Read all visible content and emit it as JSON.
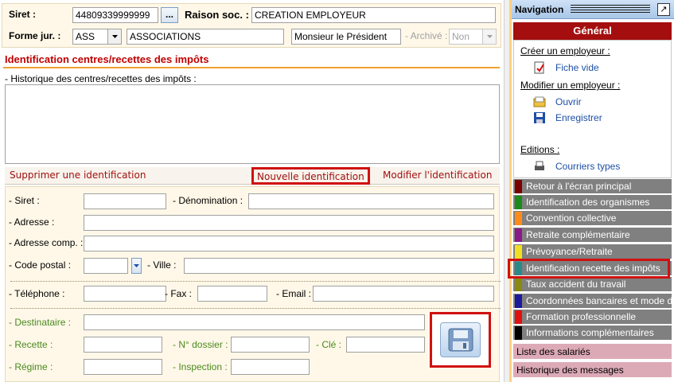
{
  "header": {
    "siret_label": "Siret :",
    "siret_value": "44809339999999",
    "dots_button": "...",
    "raison_label": "Raison soc. :",
    "raison_value": "CREATION EMPLOYEUR",
    "forme_label": "Forme jur. :",
    "forme_code": "ASS",
    "forme_name": "ASSOCIATIONS",
    "contact_value": "Monsieur le Président",
    "archive_label": "- Archivé :",
    "archive_value": "Non"
  },
  "section": {
    "title": "Identification centres/recettes des impôts",
    "history_label": "- Historique des centres/recettes des impôts :"
  },
  "actions": {
    "delete": "Supprimer une identification",
    "new": "Nouvelle identification",
    "modify": "Modifier l'identification"
  },
  "form": {
    "siret_label": "- Siret :",
    "denomination_label": "- Dénomination :",
    "adresse_label": "- Adresse :",
    "adresse_comp_label": "- Adresse comp. :",
    "code_postal_label": "- Code postal :",
    "ville_label": "- Ville :",
    "telephone_label": "- Téléphone :",
    "fax_label": "- Fax :",
    "email_label": "- Email :",
    "destinataire_label": "- Destinataire :",
    "recette_label": "- Recette :",
    "dossier_label": "- N° dossier :",
    "cle_label": "- Clé :",
    "regime_label": "- Régime :",
    "inspection_label": "- Inspection :"
  },
  "nav": {
    "title": "Navigation",
    "pin_icon": "↗",
    "general": "Général",
    "create_section": "Créer un employeur :",
    "fiche_vide": "Fiche vide",
    "modify_section": "Modifier un employeur :",
    "ouvrir": "Ouvrir",
    "enregistrer": "Enregistrer",
    "editions_section": "Editions :",
    "courriers": "Courriers types",
    "categories": [
      {
        "label": "Retour à l'écran principal",
        "color": "#7a0000"
      },
      {
        "label": "Identification des organismes",
        "color": "#1a8a1a"
      },
      {
        "label": "Convention collective",
        "color": "#ff8c1a"
      },
      {
        "label": "Retraite complémentaire",
        "color": "#8a1a8a"
      },
      {
        "label": "Prévoyance/Retraite",
        "color": "#f0e020"
      },
      {
        "label": "Identification recette des impôts",
        "color": "#2a8a8a"
      },
      {
        "label": "Taux accident du travail",
        "color": "#8a8a10"
      },
      {
        "label": "Coordonnées bancaires et mode de",
        "color": "#1a1a9a"
      },
      {
        "label": "Formation professionnelle",
        "color": "#e01010"
      },
      {
        "label": "Informations complémentaires",
        "color": "#000000"
      }
    ],
    "liste_salaries": "Liste des salariés",
    "historique_messages": "Historique des messages"
  }
}
